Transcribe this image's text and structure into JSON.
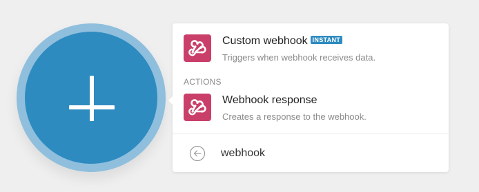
{
  "add_button": {
    "icon": "plus-icon",
    "color": "#2e8bc0",
    "ring_color": "#8fbfdd"
  },
  "panel": {
    "triggers": [
      {
        "icon": "webhook-icon",
        "title": "Custom webhook",
        "badge": "INSTANT",
        "description": "Triggers when webhook receives data."
      }
    ],
    "actions_label": "ACTIONS",
    "actions": [
      {
        "icon": "webhook-icon",
        "title": "Webhook response",
        "description": "Creates a response to the webhook."
      }
    ],
    "search": {
      "back_icon": "circle-arrow-left-icon",
      "value": "webhook"
    }
  },
  "colors": {
    "app_icon": "#c93f69",
    "badge": "#2e8bc0",
    "background": "#efefef"
  }
}
